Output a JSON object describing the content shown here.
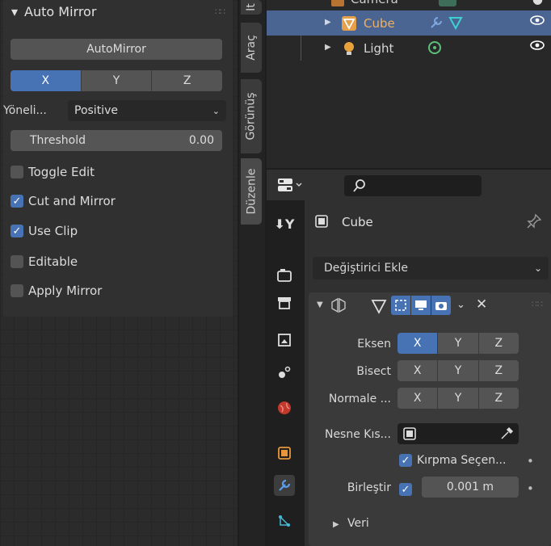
{
  "left_panel": {
    "title": "Auto Mirror",
    "main_button": "AutoMirror",
    "axis_buttons": [
      "X",
      "Y",
      "Z"
    ],
    "axis_selected": "X",
    "orientation_label": "Yöneli...",
    "orientation_value": "Positive",
    "threshold_label": "Threshold",
    "threshold_value": "0.00",
    "checkboxes": [
      {
        "label": "Toggle Edit",
        "checked": false
      },
      {
        "label": "Cut and Mirror",
        "checked": true
      },
      {
        "label": "Use Clip",
        "checked": true
      },
      {
        "label": "Editable",
        "checked": false
      },
      {
        "label": "Apply Mirror",
        "checked": false
      }
    ]
  },
  "tabs": {
    "partial": "It",
    "arac": "Araç",
    "gorunus": "Görünüş",
    "duzenle": "Düzenle"
  },
  "outliner": {
    "rows": [
      {
        "name": "Camera",
        "selected": false
      },
      {
        "name": "Cube",
        "selected": true
      },
      {
        "name": "Light",
        "selected": false
      }
    ]
  },
  "properties": {
    "object_name": "Cube",
    "add_modifier": "Değiştirici Ekle",
    "axis_label": "Eksen",
    "bisect_label": "Bisect",
    "flip_label": "Normale ...",
    "axis_x": "X",
    "axis_y": "Y",
    "axis_z": "Z",
    "mirror_object_label": "Nesne Kıs...",
    "clipping_label": "Kırpma Seçen...",
    "merge_label": "Birleştir",
    "merge_value": "0.001 m",
    "data_label": "Veri"
  },
  "colors": {
    "accent": "#4772b3",
    "selected_row": "#4a6591"
  }
}
